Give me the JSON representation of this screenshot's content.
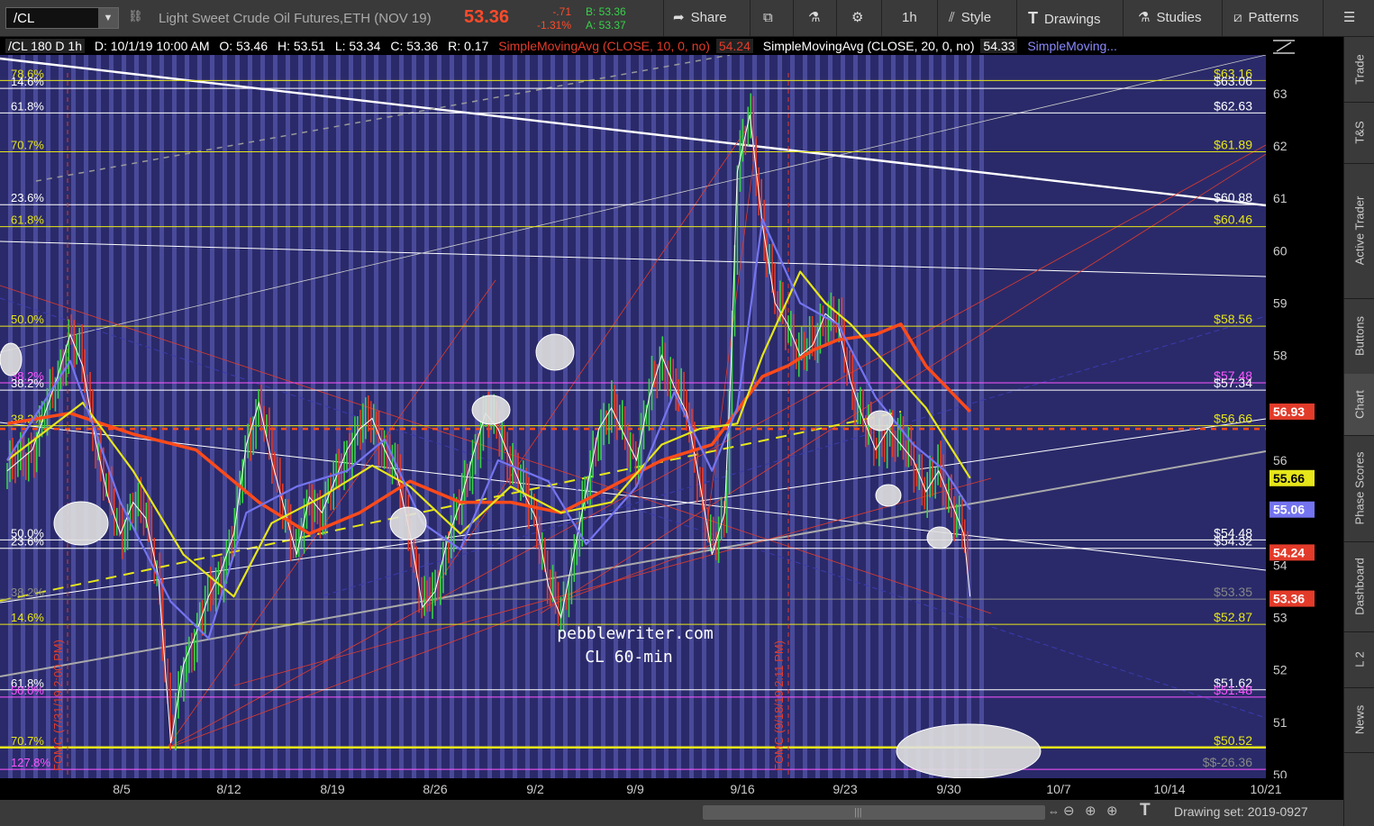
{
  "toolbar": {
    "symbol": "/CL",
    "instrument": "Light Sweet Crude Oil Futures,ETH (NOV 19)",
    "last": "53.36",
    "change": "-.71",
    "change_pct": "-1.31%",
    "bid": "B: 53.36",
    "ask": "A: 53.37",
    "buttons": {
      "share": "Share",
      "timeframe": "1h",
      "style": "Style",
      "drawings": "Drawings",
      "studies": "Studies",
      "patterns": "Patterns"
    }
  },
  "infobar": {
    "desc": "/CL 180 D 1h",
    "date": "D: 10/1/19 10:00 AM",
    "open": "O: 53.46",
    "high": "H: 53.51",
    "low": "L: 53.34",
    "close": "C: 53.36",
    "range": "R: 0.17",
    "study1": "SimpleMovingAvg (CLOSE, 10, 0, no)",
    "study1_val": "54.24",
    "study2": "SimpleMovingAvg (CLOSE, 20, 0, no)",
    "study2_val": "54.33",
    "study3": "SimpleMoving..."
  },
  "chart_data": {
    "type": "candlestick",
    "price_axis": {
      "ylim": [
        50,
        63.6
      ],
      "ticks": [
        "63",
        "62",
        "61",
        "60",
        "59",
        "58",
        "57",
        "56",
        "55",
        "54",
        "53",
        "52",
        "51",
        "50"
      ],
      "badges": [
        {
          "label": "56.93",
          "color": "#e23b2a",
          "value": 56.93
        },
        {
          "label": "55.66",
          "color": "#e6e61a",
          "value": 55.66
        },
        {
          "label": "55.06",
          "color": "#7474f0",
          "value": 55.06
        },
        {
          "label": "54.24",
          "color": "#e23b2a",
          "value": 54.24
        },
        {
          "label": "53.36",
          "color": "#e23b2a",
          "value": 53.36
        }
      ]
    },
    "time_axis": [
      "8/5",
      "8/12",
      "8/19",
      "8/26",
      "9/2",
      "9/9",
      "9/16",
      "9/23",
      "9/30",
      "10/7",
      "10/14",
      "10/21"
    ],
    "fib_left": [
      {
        "label": "78.6%",
        "value": 63.25,
        "color": "#e6e61a"
      },
      {
        "label": "14.6%",
        "value": 63.1,
        "color": "#fff"
      },
      {
        "label": "61.8%",
        "value": 62.63,
        "color": "#fff"
      },
      {
        "label": "70.7%",
        "value": 61.89,
        "color": "#e6e61a"
      },
      {
        "label": "23.6%",
        "value": 60.88,
        "color": "#fff"
      },
      {
        "label": "61.8%",
        "value": 60.46,
        "color": "#e6e61a"
      },
      {
        "label": "50.0%",
        "value": 58.56,
        "color": "#e6e61a"
      },
      {
        "label": "38.2%",
        "value": 57.48,
        "color": "#ff55ff"
      },
      {
        "label": "38.2%",
        "value": 57.34,
        "color": "#fff"
      },
      {
        "label": "38.2%",
        "value": 56.66,
        "color": "#e6e61a"
      },
      {
        "label": "50.0%",
        "value": 54.48,
        "color": "#fff"
      },
      {
        "label": "23.6%",
        "value": 54.32,
        "color": "#fff"
      },
      {
        "label": "38.2%",
        "value": 53.35,
        "color": "#888"
      },
      {
        "label": "14.6%",
        "value": 52.87,
        "color": "#e6e61a"
      },
      {
        "label": "61.8%",
        "value": 51.62,
        "color": "#fff"
      },
      {
        "label": "50.0%",
        "value": 51.48,
        "color": "#ff55ff"
      },
      {
        "label": "70.7%",
        "value": 50.52,
        "color": "#e6e61a"
      },
      {
        "label": "127.8%",
        "value": 50.1,
        "color": "#ff55ff"
      }
    ],
    "fib_right": [
      {
        "label": "$63.16",
        "value": 63.25,
        "color": "#e6e61a"
      },
      {
        "label": "$63.06",
        "value": 63.1,
        "color": "#fff"
      },
      {
        "label": "$62.63",
        "value": 62.63,
        "color": "#fff"
      },
      {
        "label": "$61.89",
        "value": 61.89,
        "color": "#e6e61a"
      },
      {
        "label": "$60.88",
        "value": 60.88,
        "color": "#fff"
      },
      {
        "label": "$60.46",
        "value": 60.46,
        "color": "#e6e61a"
      },
      {
        "label": "$58.56",
        "value": 58.56,
        "color": "#e6e61a"
      },
      {
        "label": "$57.48",
        "value": 57.48,
        "color": "#ff55ff"
      },
      {
        "label": "$57.34",
        "value": 57.34,
        "color": "#fff"
      },
      {
        "label": "$56.66",
        "value": 56.66,
        "color": "#e6e61a"
      },
      {
        "label": "$54.48",
        "value": 54.48,
        "color": "#fff"
      },
      {
        "label": "$54.32",
        "value": 54.32,
        "color": "#fff"
      },
      {
        "label": "$53.35",
        "value": 53.35,
        "color": "#888"
      },
      {
        "label": "$52.87",
        "value": 52.87,
        "color": "#e6e61a"
      },
      {
        "label": "$51.62",
        "value": 51.62,
        "color": "#fff"
      },
      {
        "label": "$51.48",
        "value": 51.48,
        "color": "#ff55ff"
      },
      {
        "label": "$50.52",
        "value": 50.52,
        "color": "#e6e61a"
      },
      {
        "label": "$$-26.36",
        "value": 50.1,
        "color": "#888"
      }
    ],
    "watermark": [
      "pebblewriter.com",
      "CL 60-min"
    ],
    "events": [
      "FOMC (7/31/19 2:00 PM)",
      "FOMC (9/18/19 2:11 PM)"
    ],
    "sma_dashed_value": 56.6,
    "sma10_color": "#7474f0",
    "sma20_color": "#e6e61a",
    "sma50_color": "#ff4a1a",
    "bar_color_up": "#38d24a",
    "bar_color_down": "#e23b2a",
    "price_path": [
      [
        0,
        55.8
      ],
      [
        0.02,
        56.2
      ],
      [
        0.04,
        57.6
      ],
      [
        0.05,
        58.4
      ],
      [
        0.06,
        57.8
      ],
      [
        0.07,
        56.4
      ],
      [
        0.08,
        55.3
      ],
      [
        0.09,
        54.6
      ],
      [
        0.1,
        55.2
      ],
      [
        0.11,
        54.9
      ],
      [
        0.12,
        53.8
      ],
      [
        0.13,
        50.6
      ],
      [
        0.14,
        52.1
      ],
      [
        0.15,
        52.7
      ],
      [
        0.16,
        53.4
      ],
      [
        0.17,
        53.9
      ],
      [
        0.18,
        54.6
      ],
      [
        0.19,
        56.3
      ],
      [
        0.2,
        57.1
      ],
      [
        0.21,
        56.0
      ],
      [
        0.22,
        55.1
      ],
      [
        0.23,
        54.2
      ],
      [
        0.24,
        55.3
      ],
      [
        0.25,
        55.0
      ],
      [
        0.26,
        55.6
      ],
      [
        0.27,
        56.2
      ],
      [
        0.28,
        56.6
      ],
      [
        0.29,
        56.8
      ],
      [
        0.3,
        56.2
      ],
      [
        0.31,
        55.7
      ],
      [
        0.32,
        54.6
      ],
      [
        0.33,
        53.2
      ],
      [
        0.34,
        53.5
      ],
      [
        0.35,
        54.5
      ],
      [
        0.36,
        55.2
      ],
      [
        0.37,
        56.1
      ],
      [
        0.38,
        56.9
      ],
      [
        0.39,
        56.6
      ],
      [
        0.4,
        56.0
      ],
      [
        0.41,
        55.4
      ],
      [
        0.42,
        54.9
      ],
      [
        0.43,
        53.6
      ],
      [
        0.44,
        53.0
      ],
      [
        0.45,
        54.2
      ],
      [
        0.46,
        55.4
      ],
      [
        0.47,
        56.6
      ],
      [
        0.48,
        57.0
      ],
      [
        0.49,
        56.5
      ],
      [
        0.5,
        56.0
      ],
      [
        0.51,
        57.2
      ],
      [
        0.52,
        58.0
      ],
      [
        0.53,
        57.4
      ],
      [
        0.54,
        56.9
      ],
      [
        0.55,
        55.6
      ],
      [
        0.56,
        54.2
      ],
      [
        0.57,
        55.0
      ],
      [
        0.575,
        57.8
      ],
      [
        0.58,
        61.5
      ],
      [
        0.59,
        62.6
      ],
      [
        0.6,
        60.5
      ],
      [
        0.61,
        59.0
      ],
      [
        0.62,
        58.6
      ],
      [
        0.63,
        58.0
      ],
      [
        0.64,
        58.2
      ],
      [
        0.65,
        58.8
      ],
      [
        0.66,
        58.6
      ],
      [
        0.67,
        57.5
      ],
      [
        0.68,
        56.8
      ],
      [
        0.69,
        56.2
      ],
      [
        0.7,
        56.6
      ],
      [
        0.71,
        56.3
      ],
      [
        0.72,
        56.0
      ],
      [
        0.73,
        55.4
      ],
      [
        0.74,
        55.8
      ],
      [
        0.75,
        55.2
      ],
      [
        0.76,
        54.6
      ],
      [
        0.765,
        53.4
      ]
    ],
    "sma10_path": [
      [
        0,
        56.0
      ],
      [
        0.05,
        57.9
      ],
      [
        0.09,
        55.2
      ],
      [
        0.13,
        53.3
      ],
      [
        0.16,
        52.6
      ],
      [
        0.19,
        55.0
      ],
      [
        0.23,
        55.5
      ],
      [
        0.27,
        55.8
      ],
      [
        0.3,
        56.4
      ],
      [
        0.33,
        54.8
      ],
      [
        0.36,
        54.3
      ],
      [
        0.39,
        56.0
      ],
      [
        0.43,
        55.6
      ],
      [
        0.46,
        54.4
      ],
      [
        0.5,
        55.5
      ],
      [
        0.53,
        57.3
      ],
      [
        0.56,
        55.8
      ],
      [
        0.58,
        57.0
      ],
      [
        0.6,
        60.6
      ],
      [
        0.63,
        59.0
      ],
      [
        0.66,
        58.6
      ],
      [
        0.69,
        57.2
      ],
      [
        0.72,
        56.3
      ],
      [
        0.745,
        55.8
      ],
      [
        0.765,
        55.06
      ]
    ],
    "sma20_path": [
      [
        0,
        56.0
      ],
      [
        0.06,
        57.1
      ],
      [
        0.1,
        55.8
      ],
      [
        0.14,
        54.2
      ],
      [
        0.18,
        53.4
      ],
      [
        0.21,
        54.8
      ],
      [
        0.25,
        55.3
      ],
      [
        0.29,
        55.9
      ],
      [
        0.32,
        55.5
      ],
      [
        0.36,
        54.6
      ],
      [
        0.4,
        55.5
      ],
      [
        0.44,
        55.0
      ],
      [
        0.48,
        55.2
      ],
      [
        0.52,
        56.3
      ],
      [
        0.55,
        56.6
      ],
      [
        0.58,
        56.7
      ],
      [
        0.6,
        58.0
      ],
      [
        0.63,
        59.6
      ],
      [
        0.65,
        59.0
      ],
      [
        0.67,
        58.6
      ],
      [
        0.7,
        57.8
      ],
      [
        0.73,
        57.0
      ],
      [
        0.765,
        55.66
      ]
    ],
    "sma50_path": [
      [
        0,
        56.7
      ],
      [
        0.05,
        56.9
      ],
      [
        0.1,
        56.5
      ],
      [
        0.15,
        56.2
      ],
      [
        0.2,
        55.2
      ],
      [
        0.24,
        54.6
      ],
      [
        0.28,
        55.0
      ],
      [
        0.32,
        55.6
      ],
      [
        0.36,
        55.2
      ],
      [
        0.4,
        55.2
      ],
      [
        0.44,
        55.0
      ],
      [
        0.48,
        55.5
      ],
      [
        0.52,
        56.0
      ],
      [
        0.56,
        56.3
      ],
      [
        0.6,
        57.6
      ],
      [
        0.62,
        57.8
      ],
      [
        0.64,
        58.1
      ],
      [
        0.66,
        58.3
      ],
      [
        0.69,
        58.4
      ],
      [
        0.71,
        58.6
      ],
      [
        0.73,
        57.8
      ],
      [
        0.765,
        56.93
      ]
    ]
  },
  "sidebar": {
    "tabs": [
      "Trade",
      "T&S",
      "Active Trader",
      "Buttons",
      "Chart",
      "Phase Scores",
      "Dashboard",
      "L 2",
      "News"
    ]
  },
  "bottombar": {
    "drawing_set": "Drawing set: 2019-0927"
  }
}
